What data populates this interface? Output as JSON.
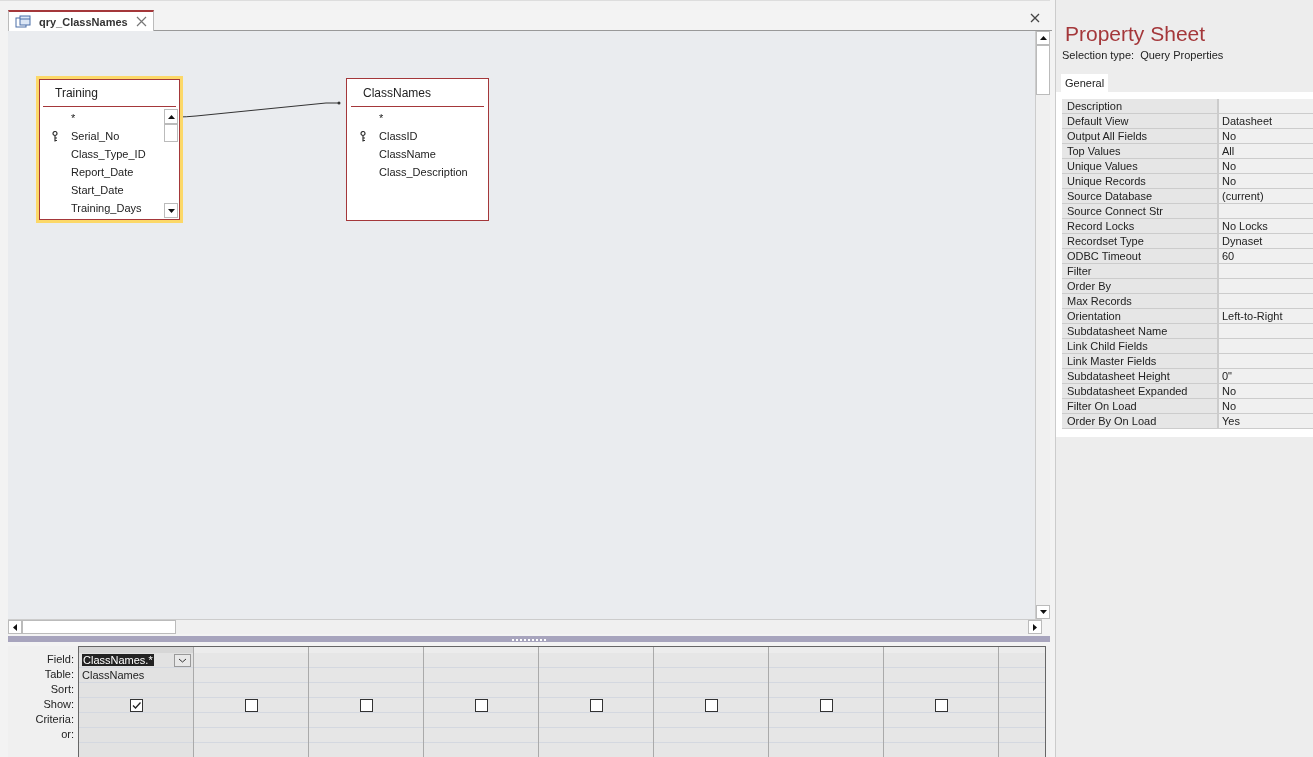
{
  "document_tab": {
    "title": "qry_ClassNames"
  },
  "tables": [
    {
      "name": "Training",
      "selected": true,
      "scrollbar": true,
      "fields": [
        {
          "name": "*",
          "key": false
        },
        {
          "name": "Serial_No",
          "key": true
        },
        {
          "name": "Class_Type_ID",
          "key": false
        },
        {
          "name": "Report_Date",
          "key": false
        },
        {
          "name": "Start_Date",
          "key": false
        },
        {
          "name": "Training_Days",
          "key": false
        }
      ]
    },
    {
      "name": "ClassNames",
      "selected": false,
      "scrollbar": false,
      "fields": [
        {
          "name": "*",
          "key": false
        },
        {
          "name": "ClassID",
          "key": true
        },
        {
          "name": "ClassName",
          "key": false
        },
        {
          "name": "Class_Description",
          "key": false
        }
      ]
    }
  ],
  "grid": {
    "row_labels": [
      "Field:",
      "Table:",
      "Sort:",
      "Show:",
      "Criteria:",
      "or:"
    ],
    "columns": [
      {
        "field": "ClassNames.*",
        "table": "ClassNames",
        "show": true,
        "selected": true
      },
      {
        "show": false,
        "selected": false
      },
      {
        "show": false,
        "selected": false
      },
      {
        "show": false,
        "selected": false
      },
      {
        "show": false,
        "selected": false
      },
      {
        "show": false,
        "selected": false
      },
      {
        "show": false,
        "selected": false
      },
      {
        "show": false,
        "selected": false
      }
    ]
  },
  "property_sheet": {
    "title": "Property Sheet",
    "selection_label": "Selection type:",
    "selection_type": "Query Properties",
    "tabs": [
      {
        "label": "General",
        "selected": true
      }
    ],
    "properties": [
      {
        "name": "Description"
      },
      {
        "name": "Default View",
        "value": "Datasheet"
      },
      {
        "name": "Output All Fields",
        "value": "No"
      },
      {
        "name": "Top Values",
        "value": "All"
      },
      {
        "name": "Unique Values",
        "value": "No"
      },
      {
        "name": "Unique Records",
        "value": "No"
      },
      {
        "name": "Source Database",
        "value": "(current)"
      },
      {
        "name": "Source Connect Str"
      },
      {
        "name": "Record Locks",
        "value": "No Locks"
      },
      {
        "name": "Recordset Type",
        "value": "Dynaset"
      },
      {
        "name": "ODBC Timeout",
        "value": "60"
      },
      {
        "name": "Filter"
      },
      {
        "name": "Order By"
      },
      {
        "name": "Max Records"
      },
      {
        "name": "Orientation",
        "value": "Left-to-Right"
      },
      {
        "name": "Subdatasheet Name"
      },
      {
        "name": "Link Child Fields"
      },
      {
        "name": "Link Master Fields"
      },
      {
        "name": "Subdatasheet Height",
        "value": "0\""
      },
      {
        "name": "Subdatasheet Expanded",
        "value": "No"
      },
      {
        "name": "Filter On Load",
        "value": "No"
      },
      {
        "name": "Order By On Load",
        "value": "Yes"
      }
    ]
  }
}
